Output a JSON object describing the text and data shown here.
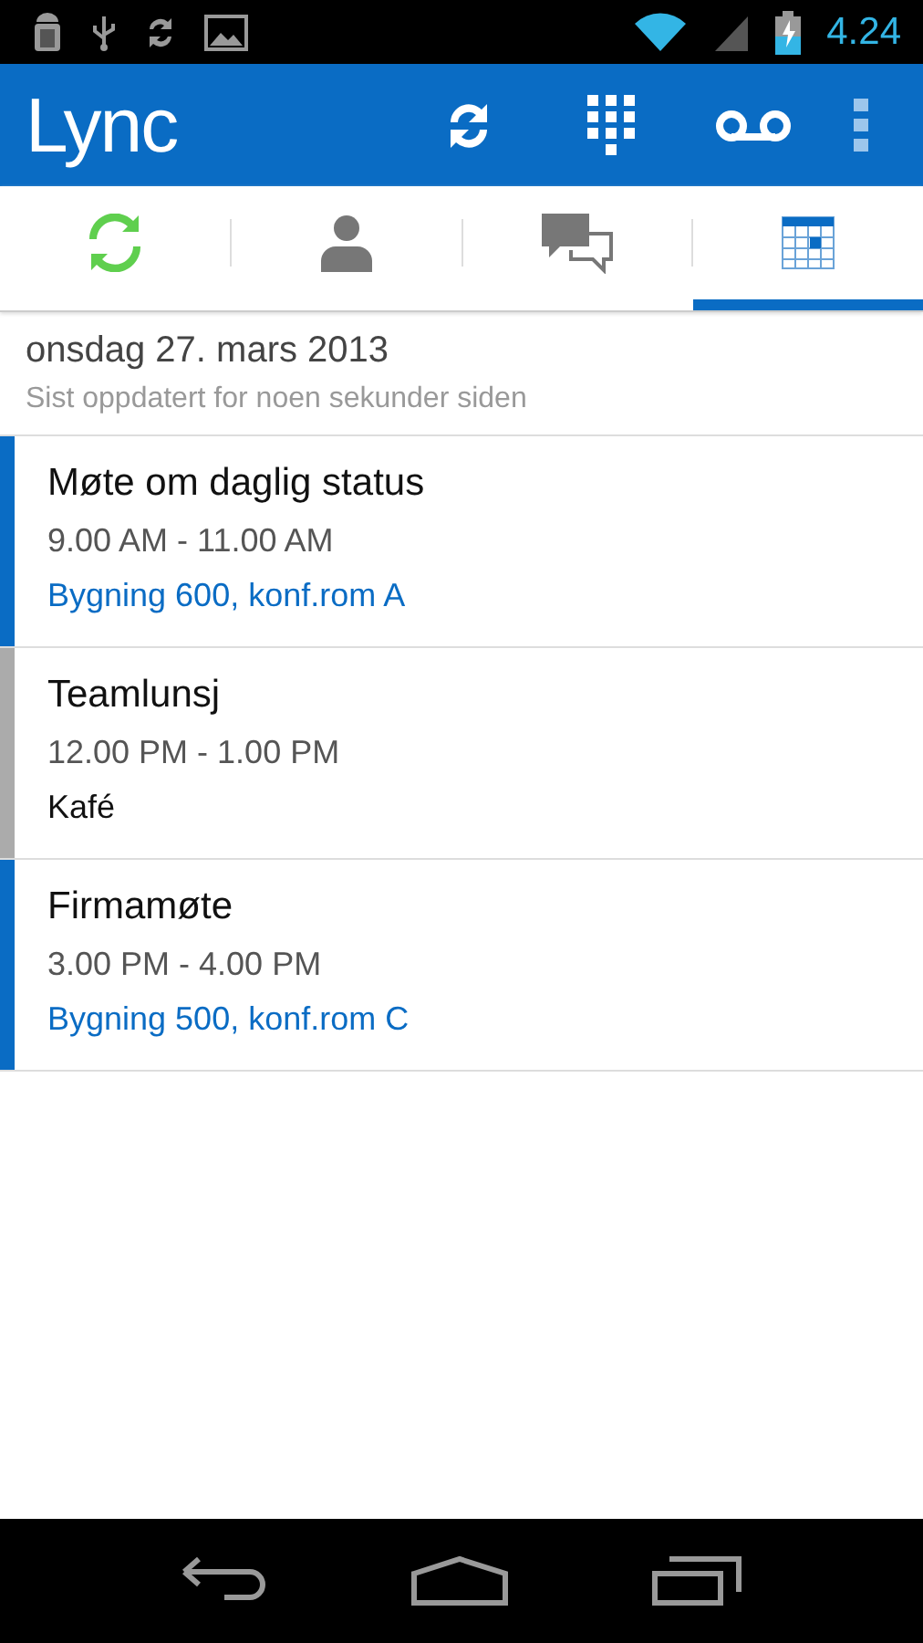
{
  "status_bar": {
    "time": "4.24"
  },
  "app_bar": {
    "title": "Lync"
  },
  "tabs": [
    {
      "selected": false
    },
    {
      "selected": false
    },
    {
      "selected": false
    },
    {
      "selected": true
    }
  ],
  "header": {
    "date": "onsdag 27. mars 2013",
    "updated": "Sist oppdatert for noen sekunder siden"
  },
  "events": [
    {
      "title": "Møte om daglig status",
      "time": "9.00 AM - 11.00 AM",
      "location": "Bygning 600, konf.rom A",
      "location_link": true,
      "color": "#0a6cc4"
    },
    {
      "title": "Teamlunsj",
      "time": "12.00 PM - 1.00 PM",
      "location": "Kafé",
      "location_link": false,
      "color": "#ababab"
    },
    {
      "title": "Firmamøte",
      "time": "3.00 PM - 4.00 PM",
      "location": "Bygning 500, konf.rom C",
      "location_link": true,
      "color": "#0a6cc4"
    }
  ]
}
